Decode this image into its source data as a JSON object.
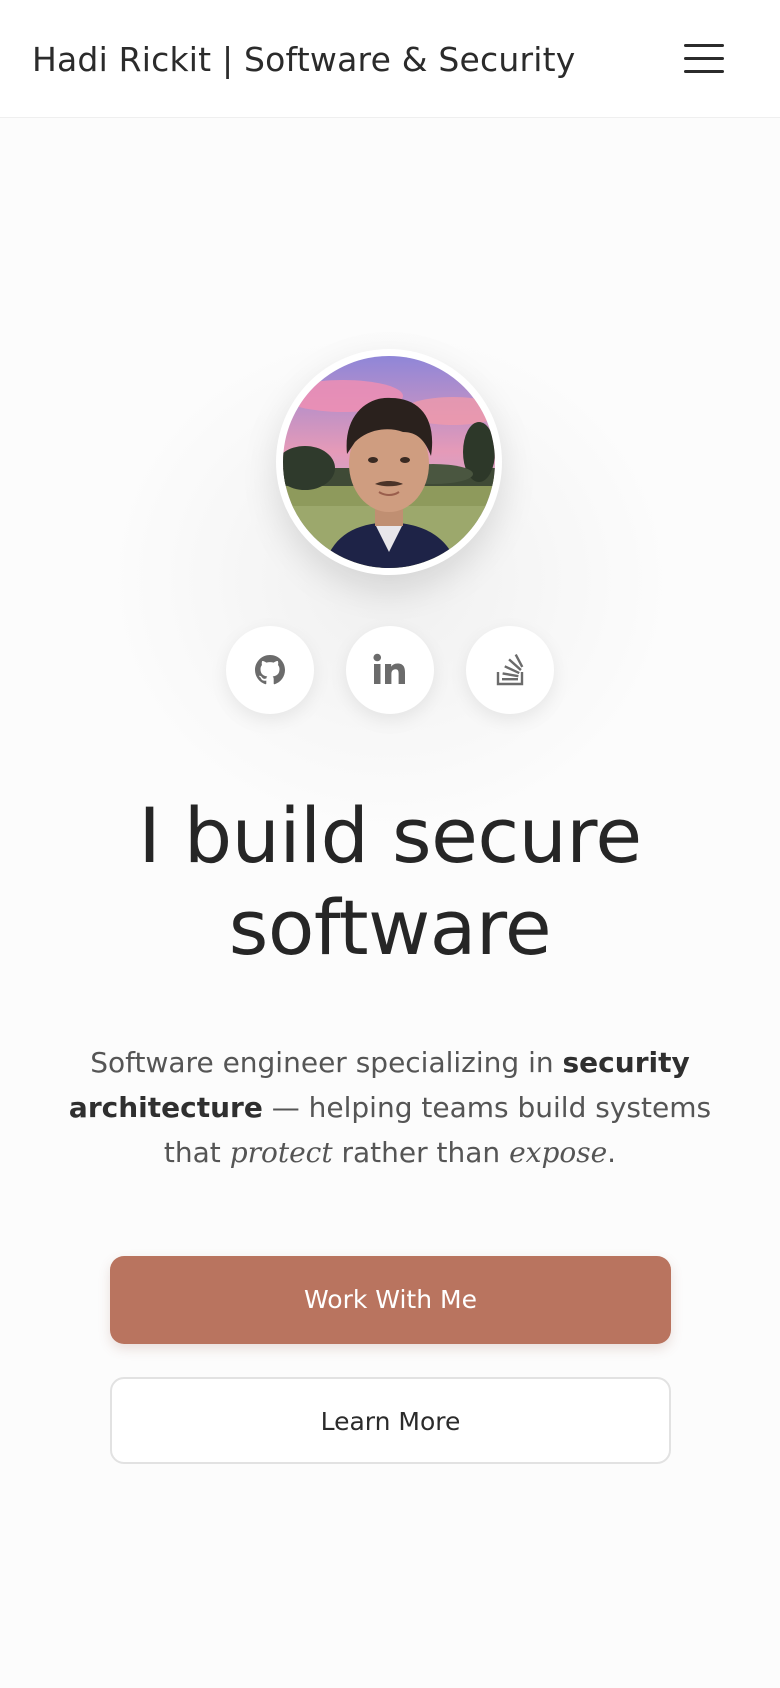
{
  "header": {
    "site_title": "Hadi Rickit | Software & Security",
    "menu_icon": "hamburger-menu-icon"
  },
  "hero": {
    "avatar_icon": "profile-photo",
    "social_links": [
      {
        "name": "GitHub",
        "icon": "github-icon"
      },
      {
        "name": "LinkedIn",
        "icon": "linkedin-icon"
      },
      {
        "name": "Stack Overflow",
        "icon": "stackoverflow-icon"
      }
    ],
    "headline_line1": "I build secure",
    "headline_line2": "software",
    "tagline": {
      "part1": "Software engineer specializing in ",
      "bold": "security architecture",
      "part2": " — helping teams build systems that ",
      "em1": "protect",
      "part3": " rather than ",
      "em2": "expose",
      "part4": "."
    }
  },
  "actions": {
    "primary_label": "Work With Me",
    "secondary_label": "Learn More"
  },
  "colors": {
    "accent": "#b9745f",
    "text": "#2b2b2b",
    "background": "#fcfcfc"
  }
}
